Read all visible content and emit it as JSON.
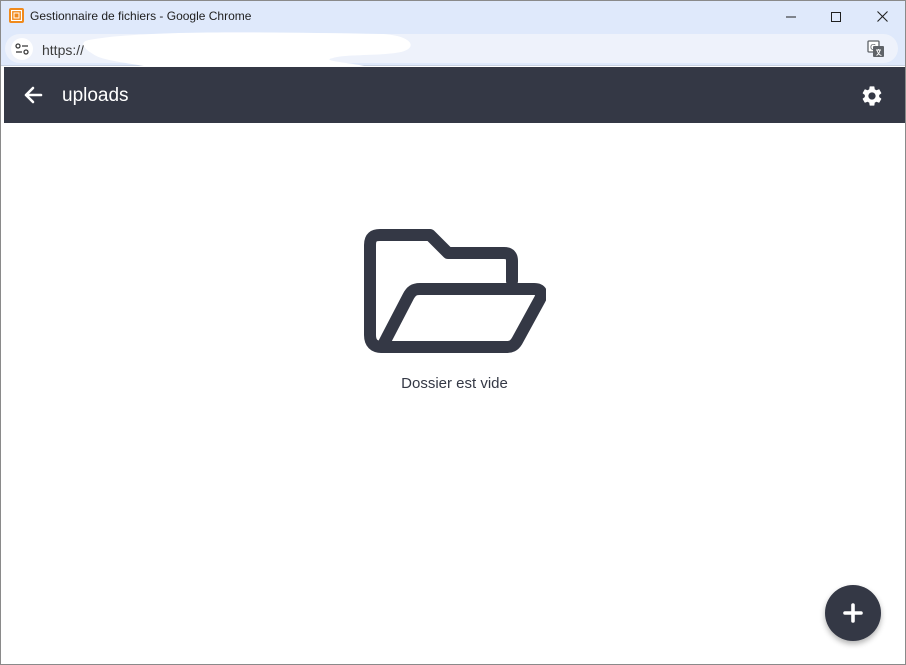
{
  "window": {
    "title": "Gestionnaire de fichiers - Google Chrome"
  },
  "address_bar": {
    "url": "https://"
  },
  "header": {
    "title": "uploads"
  },
  "content": {
    "empty_message": "Dossier est vide"
  },
  "colors": {
    "header_bg": "#343845",
    "titlebar_bg": "#dfe9fb",
    "accent": "#343845"
  },
  "icons": {
    "back": "arrow-left-icon",
    "settings": "gear-icon",
    "empty": "folder-open-icon",
    "add": "plus-icon"
  }
}
